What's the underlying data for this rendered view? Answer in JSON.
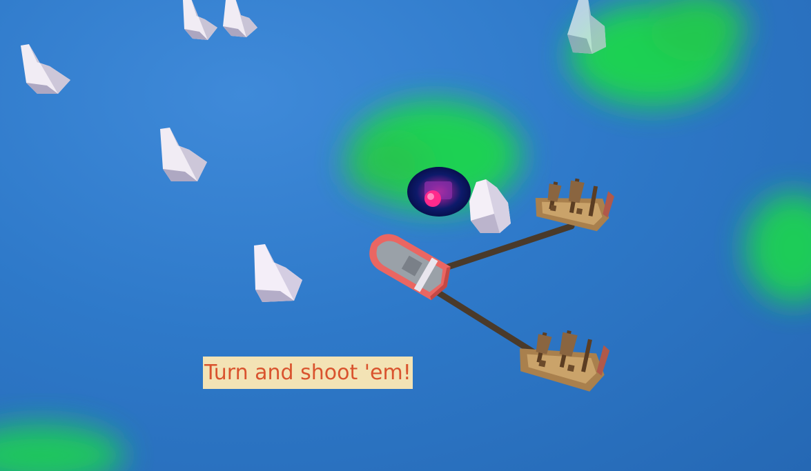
{
  "tutorial": {
    "hint_text": "Turn and shoot 'em!"
  },
  "colors": {
    "ocean": "#2e79c9",
    "fog": "#1fd64e",
    "hint_bg": "#f3e3b5",
    "hint_text": "#d9532e",
    "player_boat": "#e8635f",
    "portal": "#0a1460",
    "portal_core": "#ff1f8a",
    "tow_rope": "#4a3a2a",
    "enemy_ship": "#a67a4a"
  },
  "scene": {
    "portal": {
      "icon": "portal-icon"
    },
    "player": {
      "icon": "player-boat-icon"
    },
    "enemies": [
      {
        "icon": "pirate-ship-icon"
      },
      {
        "icon": "pirate-ship-icon"
      }
    ]
  }
}
